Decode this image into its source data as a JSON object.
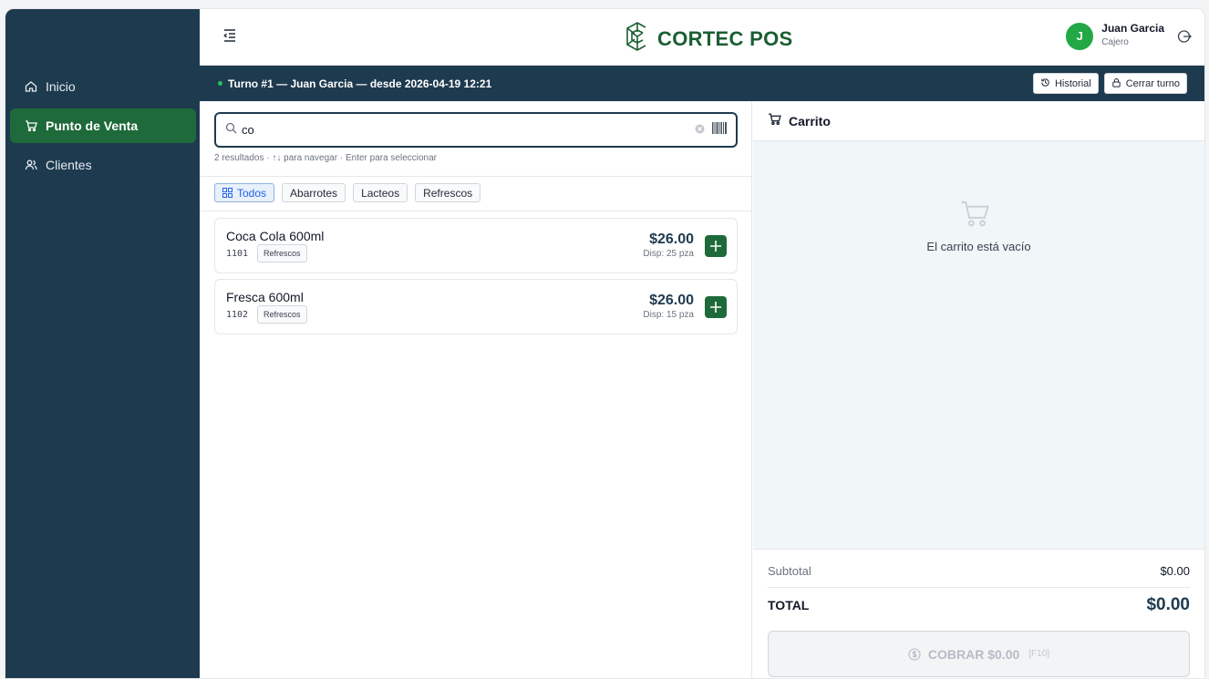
{
  "brand": {
    "name": "CORTEC POS"
  },
  "sidebar": {
    "items": [
      {
        "label": "Inicio",
        "icon": "home-icon"
      },
      {
        "label": "Punto de Venta",
        "icon": "cart-icon"
      },
      {
        "label": "Clientes",
        "icon": "users-icon"
      }
    ]
  },
  "user": {
    "initial": "J",
    "name": "Juan Garcia",
    "role": "Cajero"
  },
  "shift": {
    "text": "Turno #1 — Juan Garcia — desde 2026-04-19 12:21",
    "history_label": "Historial",
    "close_label": "Cerrar turno"
  },
  "search": {
    "value": "co",
    "hint": "2 resultados · ↑↓ para navegar · Enter para seleccionar"
  },
  "filters": [
    "Todos",
    "Abarrotes",
    "Lacteos",
    "Refrescos"
  ],
  "products": [
    {
      "name": "Coca Cola 600ml",
      "code": "1101",
      "category": "Refrescos",
      "price": "$26.00",
      "stock": "Disp: 25 pza"
    },
    {
      "name": "Fresca 600ml",
      "code": "1102",
      "category": "Refrescos",
      "price": "$26.00",
      "stock": "Disp: 15 pza"
    }
  ],
  "cart": {
    "title": "Carrito",
    "empty_text": "El carrito está vacío",
    "subtotal_label": "Subtotal",
    "subtotal_value": "$0.00",
    "total_label": "TOTAL",
    "total_value": "$0.00",
    "charge_label": "COBRAR $0.00",
    "charge_key": "[F10]"
  },
  "colors": {
    "sidebar": "#1e3a4f",
    "accent": "#1f6a3a",
    "avatar": "#22a845"
  }
}
